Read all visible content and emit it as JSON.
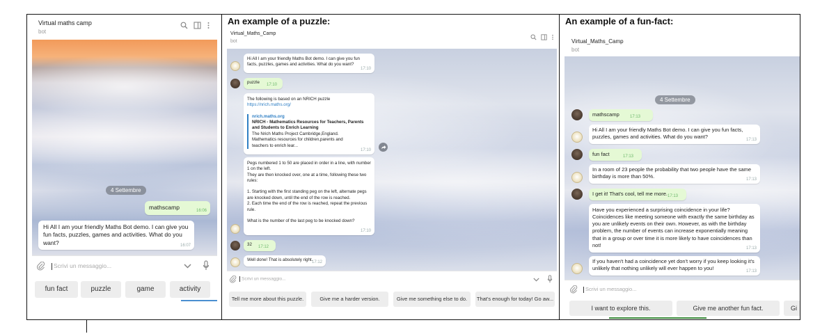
{
  "captions": {
    "puzzle": "An example of a puzzle:",
    "funfact": "An example of a fun-fact:"
  },
  "panel1": {
    "title": "Virtual maths camp",
    "subtitle": "bot",
    "date_badge": "4 Settembre",
    "messages": [
      {
        "text": "mathscamp",
        "time": "16:06",
        "dir": "out"
      },
      {
        "text": "Hi All I am your friendly Maths Bot demo. I can give you fun facts, puzzles, games and activities. What do you want?",
        "time": "16:07",
        "dir": "in"
      }
    ],
    "input_placeholder": "Scrivi un messaggio...",
    "keyboard": [
      "fun fact",
      "puzzle",
      "game",
      "activity"
    ]
  },
  "panel2": {
    "title": "Virtual_Maths_Camp",
    "subtitle": "bot",
    "messages": {
      "m1": {
        "text": "Hi All I am your friendly Maths Bot demo. I can give you fun facts, puzzles, games and activities. What do you want?",
        "time": "17:10"
      },
      "m2": {
        "text": "puzzle",
        "time": "17:10"
      },
      "m3": {
        "line1": "The following is based on an NRICH puzzle",
        "link": "https://nrich.maths.org/",
        "preview_site": "nrich.maths.org",
        "preview_title": "NRICH - Mathematics Resources for Teachers, Parents and Students to Enrich Learning",
        "preview_desc": "The Nrich Maths Project Cambridge,England. Mathematics resources for children,parents and teachers to enrich lear...",
        "time": "17:10"
      },
      "m4": {
        "p1": "Pegs numbered 1 to 50 are placed in order in a line, with number 1 on the left.",
        "p2": "They are then knocked over, one at a time, following these two rules:",
        "p3": "1. Starting with the first standing peg on the left, alternate pegs are knocked down, until the end of the row is reached.",
        "p4": "2. Each time the end of the row is reached, repeat the previous rule.",
        "p5": "What is the number of the last peg to be knocked down?",
        "time": "17:10"
      },
      "m5": {
        "text": "32",
        "time": "17:12"
      },
      "m6": {
        "text": "Well done! That is absolutely right.",
        "time": "17:12"
      }
    },
    "input_placeholder": "Scrivi un messaggio...",
    "keyboard": [
      "Tell me more about this puzzle.",
      "Give me a harder version.",
      "Give me something else to do.",
      "That's enough for today! Go aw..."
    ]
  },
  "panel3": {
    "title": "Virtual_Maths_Camp",
    "subtitle": "bot",
    "date_badge": "4 Settembre",
    "messages": {
      "m1": {
        "text": "mathscamp",
        "time": "17:13"
      },
      "m2": {
        "text": "Hi All I am your friendly Maths Bot demo. I can give you fun facts, puzzles, games and activities. What do you want?",
        "time": "17:13"
      },
      "m3": {
        "text": "fun fact",
        "time": "17:13"
      },
      "m4": {
        "text": "In a room of 23 people the probability that two people have the same birthday is more than 50%.",
        "time": "17:13"
      },
      "m5": {
        "text": "I get it! That's cool, tell me more.",
        "time": "17:13"
      },
      "m6": {
        "text": "Have you experienced a surprising coincidence in your life? Coincidences like meeting someone with exactly the same birthday as you are unlikely events on their own. However, as with the birthday problem, the number of events can increase exponentially meaning that in a group or over time it is more likely to have coincidences than not!",
        "time": "17:13"
      },
      "m7": {
        "text": "If you haven't had a coincidence yet don't worry if you keep looking it's unlikely that nothing unlikely will ever happen to you!",
        "time": "17:13"
      }
    },
    "input_placeholder": "Scrivi un messaggio...",
    "keyboard": [
      "I want to explore this.",
      "Give me another fun fact.",
      "Gi"
    ]
  }
}
